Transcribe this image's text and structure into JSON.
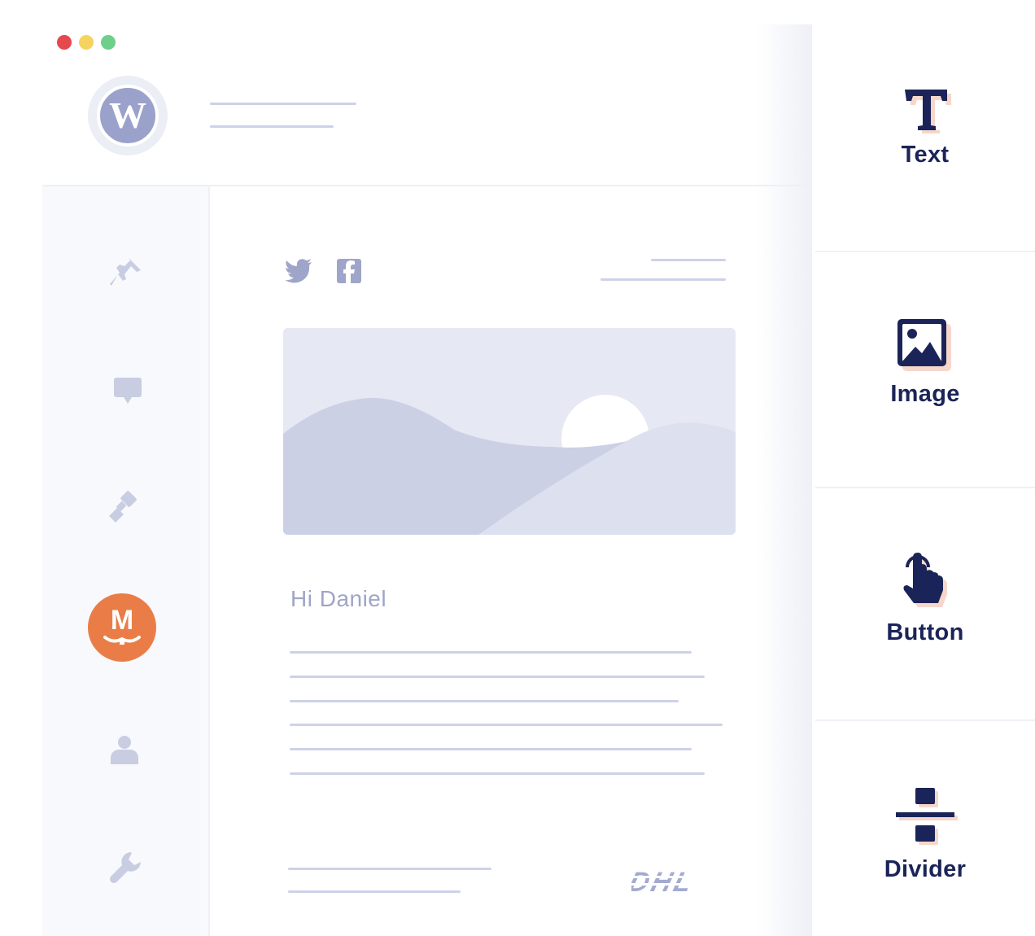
{
  "window_controls": [
    "close",
    "minimize",
    "maximize"
  ],
  "brand": {
    "logo_icon": "wordpress-logo-icon",
    "letter": "W"
  },
  "sidebar": {
    "items": [
      {
        "icon": "pin-icon"
      },
      {
        "icon": "comment-icon"
      },
      {
        "icon": "brush-icon"
      },
      {
        "icon": "mailpoet-icon",
        "letter": "M",
        "active": true
      },
      {
        "icon": "user-icon"
      },
      {
        "icon": "wrench-icon"
      }
    ]
  },
  "email": {
    "social_icons": [
      "twitter-icon",
      "facebook-icon"
    ],
    "hero_image_icon": "landscape-placeholder",
    "greeting": "Hi Daniel",
    "footer_logo": "DHL"
  },
  "blocks_panel": {
    "items": [
      {
        "label": "Text",
        "icon": "text-icon"
      },
      {
        "label": "Image",
        "icon": "image-icon"
      },
      {
        "label": "Button",
        "icon": "pointer-icon"
      },
      {
        "label": "Divider",
        "icon": "divider-icon"
      }
    ]
  },
  "colors": {
    "accent": "#ea7d47",
    "navy": "#1b2458",
    "muted_icon": "#c9cde2",
    "placeholder_line": "#ced2e8"
  }
}
